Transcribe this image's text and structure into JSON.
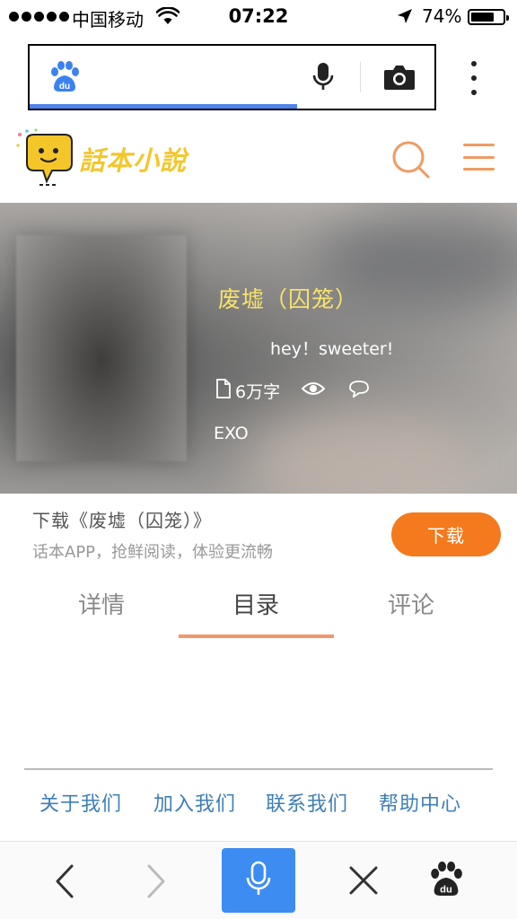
{
  "status_bar": {
    "carrier": "中国移动",
    "time": "07:22",
    "battery_text": "74%",
    "battery_level": 0.74
  },
  "browser": {
    "search_placeholder": "",
    "load_progress": 0.66,
    "icons": [
      "baidu-paw-icon",
      "microphone-icon",
      "camera-icon",
      "more-vertical-icon"
    ]
  },
  "site": {
    "name": "話本小說",
    "brand_color": "#f4c629",
    "accent_color": "#f09a62"
  },
  "book": {
    "title": "废墟（囚笼）",
    "tagline": "hey！sweeter!",
    "word_count": "6万字",
    "author": "EXO"
  },
  "download": {
    "title": "下载《废墟（囚笼）》",
    "subtitle": "话本APP，抢鲜阅读，体验更流畅",
    "button_label": "下载",
    "button_color": "#f47a1d"
  },
  "tabs": [
    {
      "label": "详情",
      "active": false
    },
    {
      "label": "目录",
      "active": true
    },
    {
      "label": "评论",
      "active": false
    }
  ],
  "footer": {
    "links": [
      "关于我们",
      "加入我们",
      "联系我们",
      "帮助中心"
    ]
  },
  "toolbar": {
    "icons": [
      "back-icon",
      "forward-icon",
      "voice-icon",
      "close-icon",
      "baidu-icon"
    ]
  }
}
